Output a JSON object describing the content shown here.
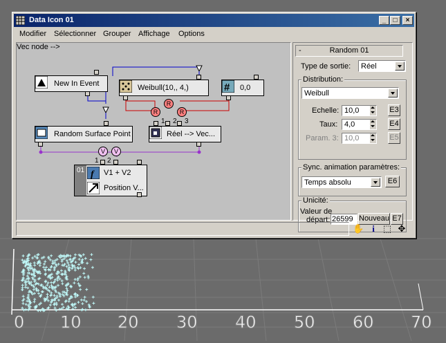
{
  "window": {
    "title": "Data Icon 01",
    "buttons": [
      "_",
      "□",
      "×"
    ]
  },
  "menu": [
    "Modifier",
    "Sélectionner",
    "Grouper",
    "Affichage",
    "Options"
  ],
  "nodes": {
    "new_in_event": "New In Event",
    "weibull": "Weibull(10,, 4,)",
    "constant": "0,0",
    "random_surface_point": "Random Surface Point",
    "reel_vec": "Réel --> Vec...",
    "v1v2": "V1 + V2",
    "position": "Position V...",
    "badge": "01"
  },
  "port_labels": {
    "r": "R",
    "v": "V",
    "n1": "1",
    "n2": "2",
    "n3": "3",
    "m1": "1",
    "m2": "2"
  },
  "panel": {
    "header": "Random 01",
    "type_sortie_label": "Type de sortie:",
    "type_sortie_value": "Réel",
    "distribution_label": "Distribution:",
    "distribution_value": "Weibull",
    "echelle_label": "Echelle:",
    "echelle_value": "10,0",
    "echelle_btn": "E3",
    "taux_label": "Taux:",
    "taux_value": "4,0",
    "taux_btn": "E4",
    "param3_label": "Param. 3:",
    "param3_value": "10,0",
    "param3_btn": "E5",
    "sync_label": "Sync. animation paramètres:",
    "sync_value": "Temps absolu",
    "sync_btn": "E6",
    "unicite_label": "Unicité:",
    "valeur_label1": "Valeur de",
    "valeur_label2": "départ:",
    "valeur_value": "26599",
    "nouveau_btn": "Nouveau",
    "e7_btn": "E7"
  },
  "viewport": {
    "ticks": [
      "0",
      "10",
      "20",
      "30",
      "40",
      "50",
      "60",
      "70"
    ]
  },
  "colors": {
    "title_start": "#0a246a",
    "title_end": "#3a6ea5",
    "wire_blue": "#0000cc",
    "wire_red": "#cc0000",
    "wire_purple": "#9933cc",
    "particles": "#bff7f7"
  }
}
